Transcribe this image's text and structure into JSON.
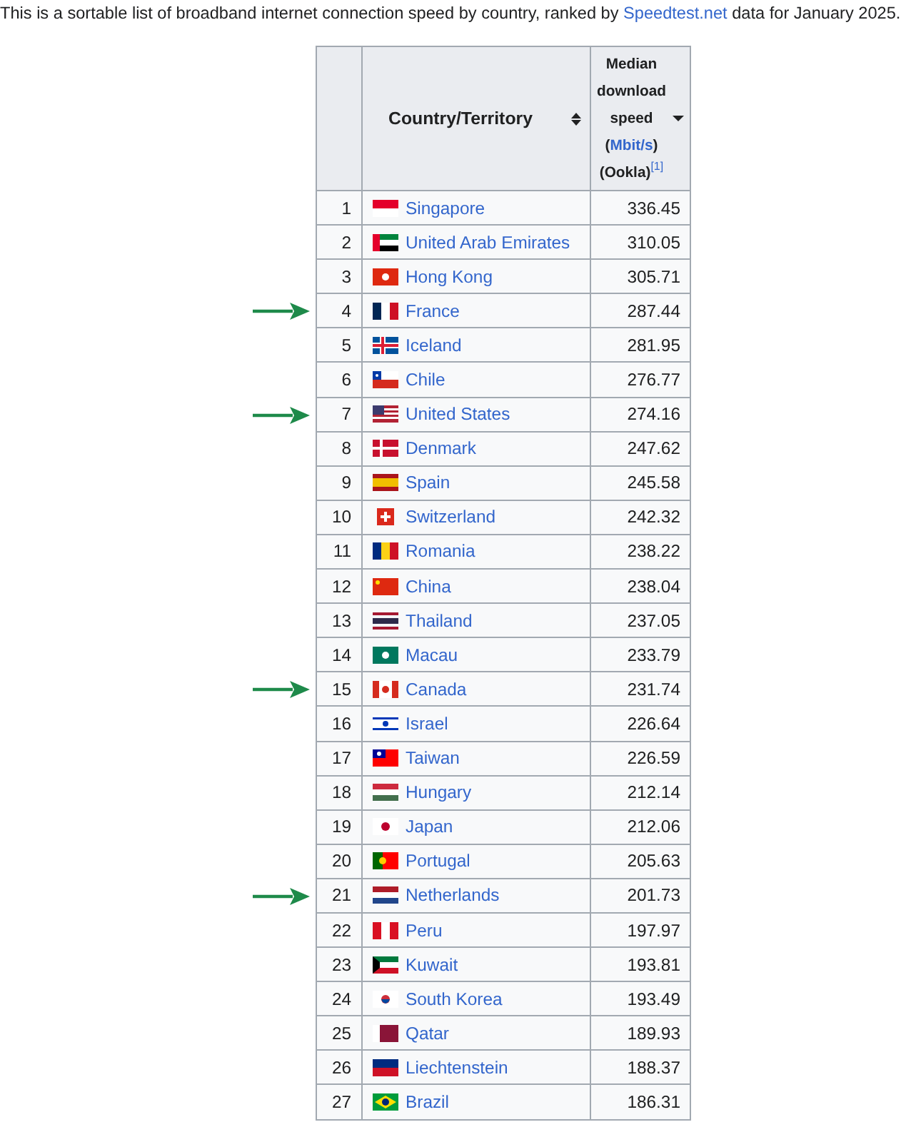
{
  "intro": {
    "before": "This is a sortable list of broadband internet connection speed by country, ranked by ",
    "link": "Speedtest.net",
    "after": " data for January 2025."
  },
  "table": {
    "columns": [
      {
        "kind": "rank"
      },
      {
        "kind": "country",
        "title": "Country/Territory",
        "sorted": false
      },
      {
        "kind": "speed",
        "lines": [
          "Median",
          "download",
          "speed"
        ],
        "unit": {
          "before": "(",
          "link": "Mbit/s",
          "after": ")"
        },
        "source": "(Ookla)",
        "ref": "[1]",
        "sorted": true
      }
    ],
    "rows": [
      {
        "rank": "1",
        "country": "Singapore",
        "speed": "336.45",
        "marked": false
      },
      {
        "rank": "2",
        "country": "United Arab Emirates",
        "speed": "310.05",
        "marked": false
      },
      {
        "rank": "3",
        "country": "Hong Kong",
        "speed": "305.71",
        "marked": false
      },
      {
        "rank": "4",
        "country": "France",
        "speed": "287.44",
        "marked": true
      },
      {
        "rank": "5",
        "country": "Iceland",
        "speed": "281.95",
        "marked": false
      },
      {
        "rank": "6",
        "country": "Chile",
        "speed": "276.77",
        "marked": false
      },
      {
        "rank": "7",
        "country": "United States",
        "speed": "274.16",
        "marked": true
      },
      {
        "rank": "8",
        "country": "Denmark",
        "speed": "247.62",
        "marked": false
      },
      {
        "rank": "9",
        "country": "Spain",
        "speed": "245.58",
        "marked": false
      },
      {
        "rank": "10",
        "country": "Switzerland",
        "speed": "242.32",
        "marked": false
      },
      {
        "rank": "11",
        "country": "Romania",
        "speed": "238.22",
        "marked": false
      },
      {
        "rank": "12",
        "country": "China",
        "speed": "238.04",
        "marked": false
      },
      {
        "rank": "13",
        "country": "Thailand",
        "speed": "237.05",
        "marked": false
      },
      {
        "rank": "14",
        "country": "Macau",
        "speed": "233.79",
        "marked": false
      },
      {
        "rank": "15",
        "country": "Canada",
        "speed": "231.74",
        "marked": true
      },
      {
        "rank": "16",
        "country": "Israel",
        "speed": "226.64",
        "marked": false
      },
      {
        "rank": "17",
        "country": "Taiwan",
        "speed": "226.59",
        "marked": false
      },
      {
        "rank": "18",
        "country": "Hungary",
        "speed": "212.14",
        "marked": false
      },
      {
        "rank": "19",
        "country": "Japan",
        "speed": "212.06",
        "marked": false
      },
      {
        "rank": "20",
        "country": "Portugal",
        "speed": "205.63",
        "marked": false
      },
      {
        "rank": "21",
        "country": "Netherlands",
        "speed": "201.73",
        "marked": true
      },
      {
        "rank": "22",
        "country": "Peru",
        "speed": "197.97",
        "marked": false
      },
      {
        "rank": "23",
        "country": "Kuwait",
        "speed": "193.81",
        "marked": false
      },
      {
        "rank": "24",
        "country": "South Korea",
        "speed": "193.49",
        "marked": false
      },
      {
        "rank": "25",
        "country": "Qatar",
        "speed": "189.93",
        "marked": false
      },
      {
        "rank": "26",
        "country": "Liechtenstein",
        "speed": "188.37",
        "marked": false
      },
      {
        "rank": "27",
        "country": "Brazil",
        "speed": "186.31",
        "marked": false
      }
    ]
  }
}
